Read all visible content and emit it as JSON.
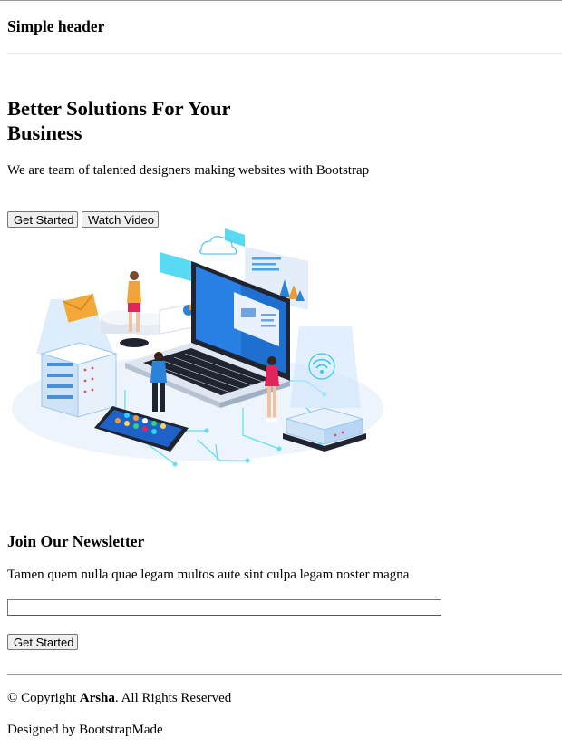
{
  "header": {
    "title": "Simple header"
  },
  "hero": {
    "title": "Better Solutions For Your Business",
    "subtitle": "We are team of talented designers making websites with Bootstrap",
    "get_started_label": "Get Started",
    "watch_video_label": "Watch Video"
  },
  "newsletter": {
    "title": "Join Our Newsletter",
    "text": "Tamen quem nulla quae legam multos aute sint culpa legam noster magna",
    "input_value": "",
    "submit_label": "Get Started"
  },
  "footer": {
    "copyright_prefix": "© Copyright ",
    "brand": "Arsha",
    "copyright_suffix": ". All Rights Reserved",
    "credits": "Designed by BootstrapMade"
  },
  "colors": {
    "accent_blue": "#1e88e5",
    "cyan": "#29d3f5",
    "dark": "#1f2430",
    "envelope": "#f0a030"
  }
}
